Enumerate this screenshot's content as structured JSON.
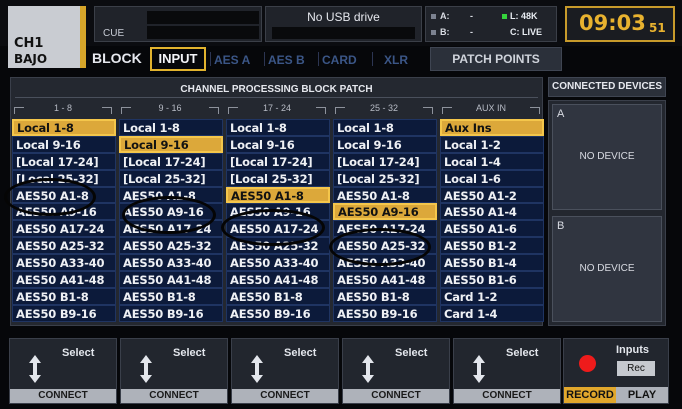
{
  "channel": {
    "name": "CH1",
    "sub": "BAJO"
  },
  "cue": {
    "label": "CUE"
  },
  "usb": {
    "status": "No USB drive"
  },
  "network": {
    "a_label": "A:",
    "a_value": "-",
    "b_label": "B:",
    "b_value": "-",
    "l_value": "L: 48K",
    "c_value": "C: LIVE"
  },
  "clock": {
    "time": "09:03",
    "seconds": "51"
  },
  "tabs": {
    "block": "BLOCK",
    "input": "INPUT",
    "others": [
      "AES A",
      "AES B",
      "CARD",
      "XLR"
    ],
    "patch_points": "PATCH POINTS"
  },
  "panel": {
    "title": "CHANNEL PROCESSING BLOCK PATCH"
  },
  "columns": [
    {
      "header": "1 - 8",
      "items": [
        "Local 1-8",
        "Local 9-16",
        "[Local 17-24]",
        "[Local 25-32]",
        "AES50 A1-8",
        "AES50 A9-16",
        "AES50 A17-24",
        "AES50 A25-32",
        "AES50 A33-40",
        "AES50 A41-48",
        "AES50 B1-8",
        "AES50 B9-16"
      ]
    },
    {
      "header": "9 - 16",
      "items": [
        "Local 1-8",
        "Local 9-16",
        "[Local 17-24]",
        "[Local 25-32]",
        "AES50 A1-8",
        "AES50 A9-16",
        "AES50 A17-24",
        "AES50 A25-32",
        "AES50 A33-40",
        "AES50 A41-48",
        "AES50 B1-8",
        "AES50 B9-16"
      ]
    },
    {
      "header": "17 - 24",
      "items": [
        "Local 1-8",
        "Local 9-16",
        "[Local 17-24]",
        "[Local 25-32]",
        "AES50 A1-8",
        "AES50 A9-16",
        "AES50 A17-24",
        "AES50 A25-32",
        "AES50 A33-40",
        "AES50 A41-48",
        "AES50 B1-8",
        "AES50 B9-16"
      ]
    },
    {
      "header": "25 - 32",
      "items": [
        "Local 1-8",
        "Local 9-16",
        "[Local 17-24]",
        "[Local 25-32]",
        "AES50 A1-8",
        "AES50 A9-16",
        "AES50 A17-24",
        "AES50 A25-32",
        "AES50 A33-40",
        "AES50 A41-48",
        "AES50 B1-8",
        "AES50 B9-16"
      ]
    },
    {
      "header": "AUX IN",
      "items": [
        "Aux Ins",
        "Local 1-2",
        "Local 1-4",
        "Local 1-6",
        "AES50 A1-2",
        "AES50 A1-4",
        "AES50 A1-6",
        "AES50 B1-2",
        "AES50 B1-4",
        "AES50 B1-6",
        "Card 1-2",
        "Card 1-4"
      ]
    }
  ],
  "selected_rows": [
    0,
    1,
    4,
    5,
    0
  ],
  "devices": {
    "title": "CONNECTED DEVICES",
    "a_label": "A",
    "b_label": "B",
    "a_status": "NO DEVICE",
    "b_status": "NO DEVICE"
  },
  "controls": {
    "select": "Select",
    "connect": "CONNECT"
  },
  "recorder": {
    "inputs": "Inputs",
    "mode": "Rec",
    "record": "RECORD",
    "play": "PLAY"
  },
  "colors": {
    "accent": "#e2b32e",
    "selected_fill": "#dca83a",
    "item_bg": "#0c1a3a",
    "record_dot": "#ee1b1b"
  }
}
